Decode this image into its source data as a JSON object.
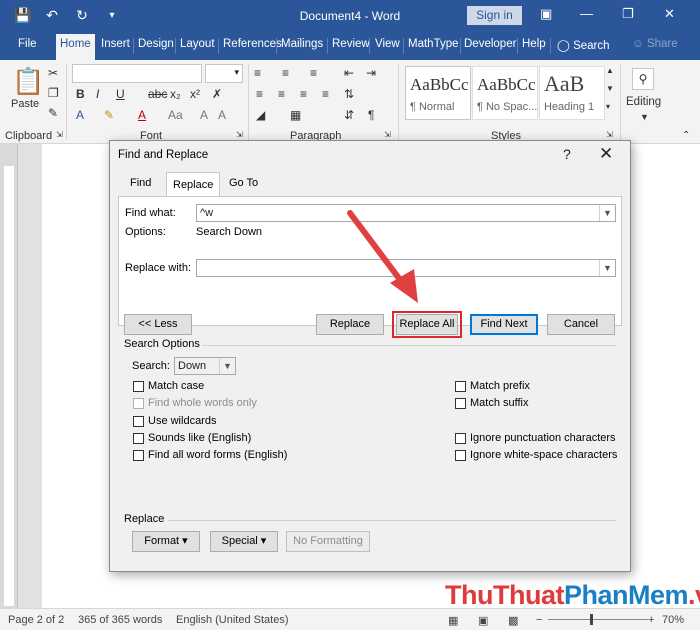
{
  "app": {
    "doc_title": "Document4  -  Word",
    "sign_in": "Sign in",
    "qat": [
      "save-icon",
      "undo-icon",
      "redo-icon",
      "customize-icon"
    ]
  },
  "tabs": [
    "File",
    "Home",
    "Insert",
    "Design",
    "Layout",
    "References",
    "Mailings",
    "Review",
    "View",
    "MathType",
    "Developer",
    "Help",
    "Search",
    "Share"
  ],
  "ribbon": {
    "clipboard_label": "Clipboard",
    "paste_label": "Paste",
    "font_label": "Font",
    "paragraph_label": "Paragraph",
    "styles_label": "Styles",
    "editing_label": "Editing",
    "styles": [
      {
        "preview": "AaBbCc",
        "name": "¶ Normal"
      },
      {
        "preview": "AaBbCc",
        "name": "¶ No Spac..."
      },
      {
        "preview": "AaB",
        "name": "Heading 1"
      }
    ]
  },
  "dialog": {
    "title": "Find and Replace",
    "help": "?",
    "tabs": [
      "Find",
      "Replace",
      "Go To"
    ],
    "find_what_label": "Find what:",
    "find_what_value": "^w",
    "options_label": "Options:",
    "options_value": "Search Down",
    "replace_with_label": "Replace with:",
    "replace_with_value": "",
    "buttons": {
      "less": "<< Less",
      "replace": "Replace",
      "replace_all": "Replace All",
      "find_next": "Find Next",
      "cancel": "Cancel"
    },
    "search_options_label": "Search Options",
    "search_label": "Search:",
    "search_value": "Down",
    "left_options": [
      {
        "label": "Match case",
        "disabled": false
      },
      {
        "label": "Find whole words only",
        "disabled": true
      },
      {
        "label": "Use wildcards",
        "disabled": false
      },
      {
        "label": "Sounds like (English)",
        "disabled": false
      },
      {
        "label": "Find all word forms (English)",
        "disabled": false
      }
    ],
    "right_options": [
      {
        "label": "Match prefix"
      },
      {
        "label": "Match suffix"
      },
      {
        "label": "Ignore punctuation characters"
      },
      {
        "label": "Ignore white-space characters"
      }
    ],
    "replace_section_label": "Replace",
    "format_btn": "Format ▾",
    "special_btn": "Special ▾",
    "no_formatting_btn": "No Formatting"
  },
  "status": {
    "page": "Page 2 of 2",
    "words": "365 of 365 words",
    "language": "English (United States)",
    "zoom": "70%"
  },
  "watermark": {
    "part1": "ThuThuat",
    "part2": "PhanMem",
    "part3": ".vn"
  },
  "colors": {
    "brand": "#2b579a",
    "highlight": "#e0252e",
    "arrow": "#e04040"
  }
}
